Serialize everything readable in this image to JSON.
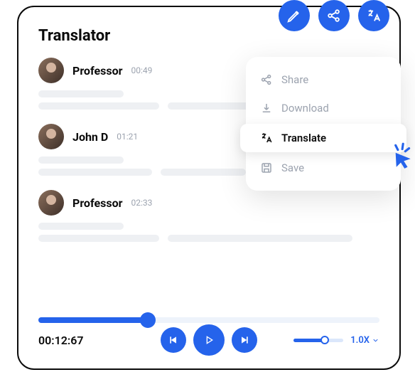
{
  "title": "Translator",
  "header_buttons": {
    "edit": "edit-icon",
    "share": "share-icon",
    "translate": "translate-icon"
  },
  "entries": [
    {
      "speaker": "Professor",
      "time": "00:49"
    },
    {
      "speaker": "John D",
      "time": "01:21"
    },
    {
      "speaker": "Professor",
      "time": "02:33"
    }
  ],
  "dropdown": {
    "items": [
      {
        "label": "Share",
        "icon": "share-icon"
      },
      {
        "label": "Download",
        "icon": "download-icon"
      },
      {
        "label": "Translate",
        "icon": "translate-icon",
        "active": true
      },
      {
        "label": "Save",
        "icon": "save-icon"
      }
    ]
  },
  "playback": {
    "current_time": "00:12:67",
    "progress_percent": 32,
    "speed_label": "1.0X",
    "speed_percent": 62
  },
  "colors": {
    "primary": "#2563eb",
    "muted": "#9ca3af",
    "skeleton": "#eef0f3"
  }
}
